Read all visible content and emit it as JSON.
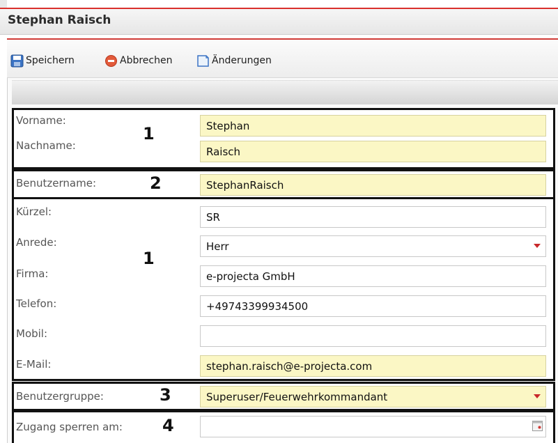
{
  "window": {
    "title": "Stephan Raisch"
  },
  "toolbar": {
    "save_label": "Speichern",
    "cancel_label": "Abbrechen",
    "changes_label": "Änderungen"
  },
  "groups": {
    "g1_number": "1",
    "g2_number": "2",
    "g3_number": "1",
    "g4_number": "3",
    "g5_number": "4"
  },
  "form": {
    "vorname": {
      "label": "Vorname:",
      "value": "Stephan"
    },
    "nachname": {
      "label": "Nachname:",
      "value": "Raisch"
    },
    "benutzername": {
      "label": "Benutzername:",
      "value": "StephanRaisch"
    },
    "kuerzel": {
      "label": "Kürzel:",
      "value": "SR"
    },
    "anrede": {
      "label": "Anrede:",
      "value": "Herr"
    },
    "firma": {
      "label": "Firma:",
      "value": "e-projecta GmbH"
    },
    "telefon": {
      "label": "Telefon:",
      "value": "+49743399934500"
    },
    "mobil": {
      "label": "Mobil:",
      "value": ""
    },
    "email": {
      "label": "E-Mail:",
      "value": "stephan.raisch@e-projecta.com"
    },
    "benutzergruppe": {
      "label": "Benutzergruppe:",
      "value": "Superuser/Feuerwehrkommandant"
    },
    "zugang_sperren": {
      "label": "Zugang sperren am:",
      "value": ""
    }
  },
  "colors": {
    "required_field_bg": "#fbf7c5",
    "accent_red": "#d9302c",
    "group_border": "#111111"
  }
}
